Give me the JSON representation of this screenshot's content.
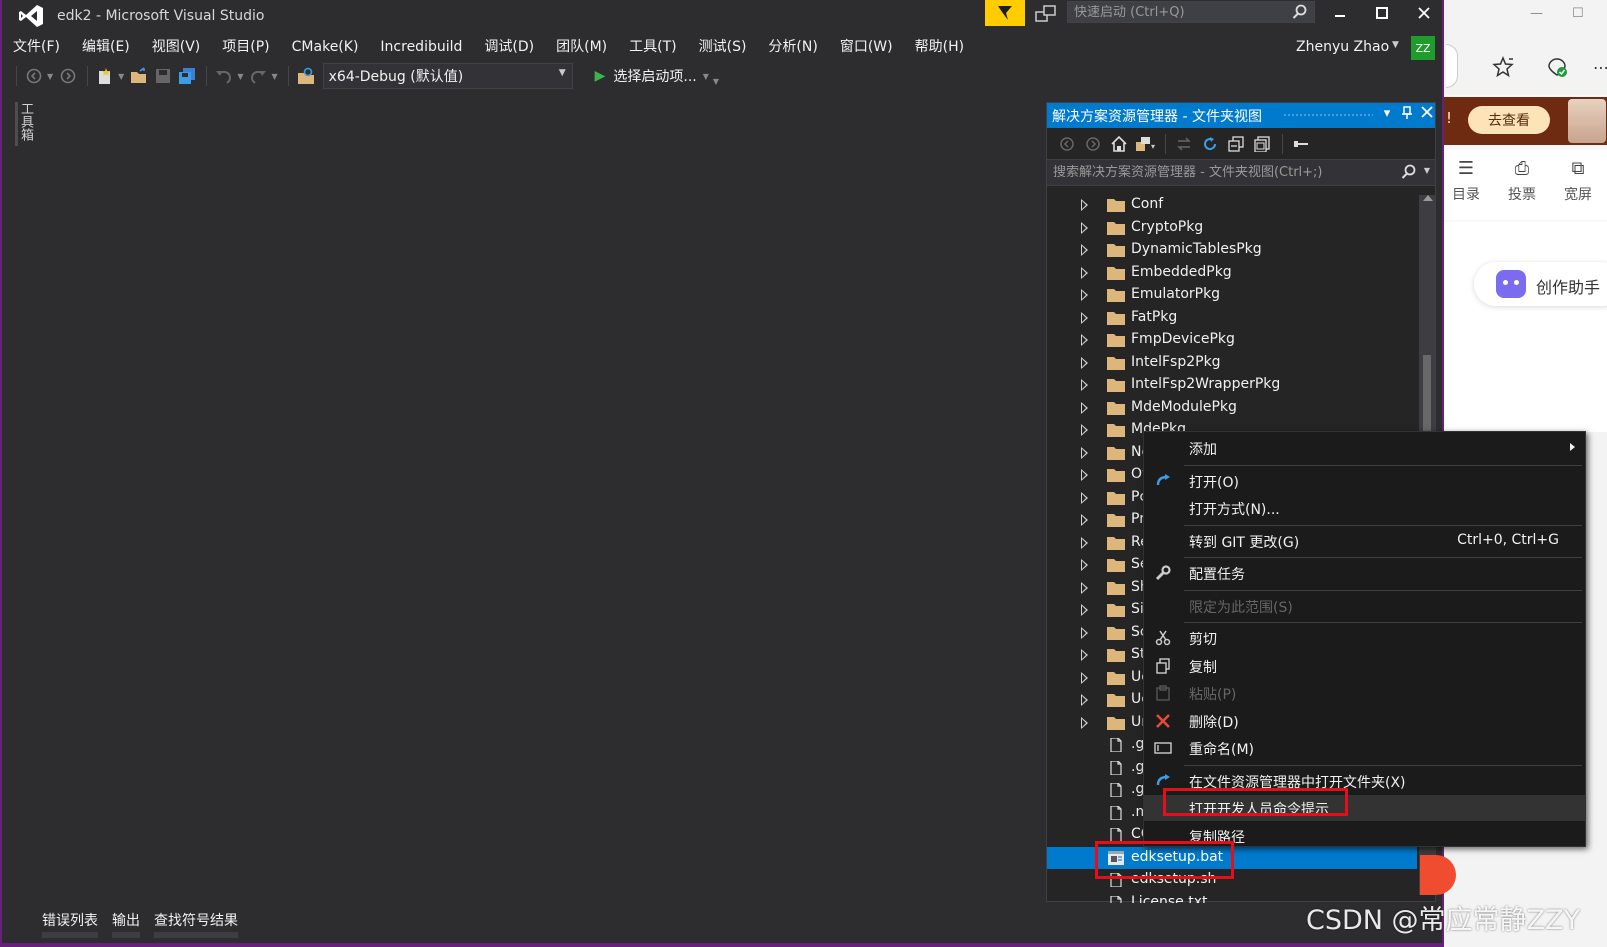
{
  "window": {
    "title": "edk2 - Microsoft Visual Studio",
    "quick_launch_placeholder": "快速启动 (Ctrl+Q)"
  },
  "menu": [
    "文件(F)",
    "编辑(E)",
    "视图(V)",
    "项目(P)",
    "CMake(K)",
    "Incredibuild",
    "调试(D)",
    "团队(M)",
    "工具(T)",
    "测试(S)",
    "分析(N)",
    "窗口(W)",
    "帮助(H)"
  ],
  "user": {
    "name": "Zhenyu Zhao",
    "initials": "ZZ"
  },
  "toolbar": {
    "config": "x64-Debug (默认值)",
    "start_label": "选择启动项..."
  },
  "toolbox_label": "工具箱",
  "solution_explorer": {
    "title": "解决方案资源管理器 - 文件夹视图",
    "search_placeholder": "搜索解决方案资源管理器 - 文件夹视图(Ctrl+;)",
    "tree": [
      {
        "label": "Conf",
        "type": "folder"
      },
      {
        "label": "CryptoPkg",
        "type": "folder"
      },
      {
        "label": "DynamicTablesPkg",
        "type": "folder"
      },
      {
        "label": "EmbeddedPkg",
        "type": "folder"
      },
      {
        "label": "EmulatorPkg",
        "type": "folder"
      },
      {
        "label": "FatPkg",
        "type": "folder"
      },
      {
        "label": "FmpDevicePkg",
        "type": "folder"
      },
      {
        "label": "IntelFsp2Pkg",
        "type": "folder"
      },
      {
        "label": "IntelFsp2WrapperPkg",
        "type": "folder"
      },
      {
        "label": "MdeModulePkg",
        "type": "folder"
      },
      {
        "label": "MdePkg",
        "type": "folder"
      },
      {
        "label": "Ne",
        "type": "folder"
      },
      {
        "label": "Ov",
        "type": "folder"
      },
      {
        "label": "Pc",
        "type": "folder"
      },
      {
        "label": "Pr",
        "type": "folder"
      },
      {
        "label": "Re",
        "type": "folder"
      },
      {
        "label": "Se",
        "type": "folder"
      },
      {
        "label": "Sh",
        "type": "folder"
      },
      {
        "label": "Si",
        "type": "folder"
      },
      {
        "label": "Sc",
        "type": "folder"
      },
      {
        "label": "St",
        "type": "folder"
      },
      {
        "label": "Ue",
        "type": "folder"
      },
      {
        "label": "Ue",
        "type": "folder"
      },
      {
        "label": "Ur",
        "type": "folder"
      },
      {
        "label": ".g",
        "type": "file"
      },
      {
        "label": ".g",
        "type": "file"
      },
      {
        "label": ".g",
        "type": "file"
      },
      {
        "label": ".m",
        "type": "file"
      },
      {
        "label": "CC",
        "type": "file"
      },
      {
        "label": "edksetup.bat",
        "type": "bat",
        "selected": true
      },
      {
        "label": "edksetup.sh",
        "type": "file"
      },
      {
        "label": "License.txt",
        "type": "file"
      }
    ]
  },
  "context_menu": [
    {
      "label": "添加",
      "submenu": true,
      "icon": ""
    },
    {
      "sep": true
    },
    {
      "label": "打开(O)",
      "icon": "open-icon"
    },
    {
      "label": "打开方式(N)...",
      "icon": ""
    },
    {
      "sep": true
    },
    {
      "label": "转到 GIT 更改(G)",
      "shortcut": "Ctrl+0, Ctrl+G",
      "icon": ""
    },
    {
      "sep": true
    },
    {
      "label": "配置任务",
      "icon": "wrench-icon"
    },
    {
      "sep": true
    },
    {
      "label": "限定为此范围(S)",
      "disabled": true,
      "icon": ""
    },
    {
      "sep": true
    },
    {
      "label": "剪切",
      "icon": "scissors-icon"
    },
    {
      "label": "复制",
      "icon": "copy-icon"
    },
    {
      "label": "粘贴(P)",
      "disabled": true,
      "icon": "paste-icon"
    },
    {
      "label": "删除(D)",
      "icon": "delete-icon"
    },
    {
      "label": "重命名(M)",
      "icon": "rename-icon"
    },
    {
      "sep": true
    },
    {
      "label": "在文件资源管理器中打开文件夹(X)",
      "icon": "open-folder-icon"
    },
    {
      "label": "打开开发人员命令提示",
      "icon": "",
      "highlight": true
    },
    {
      "label": "复制路径",
      "icon": ""
    }
  ],
  "bottom_tabs": [
    "错误列表",
    "输出",
    "查找符号结果"
  ],
  "browser": {
    "banner_button": "去查看",
    "nav": [
      "目录",
      "投票",
      "宽屏"
    ],
    "assist": "创作助手"
  },
  "watermark": "CSDN @常应常静ZZY",
  "colors": {
    "vs_accent": "#68217a",
    "selection": "#007acc",
    "highlight_border": "#e3101c",
    "folder": "#dcb67a"
  }
}
